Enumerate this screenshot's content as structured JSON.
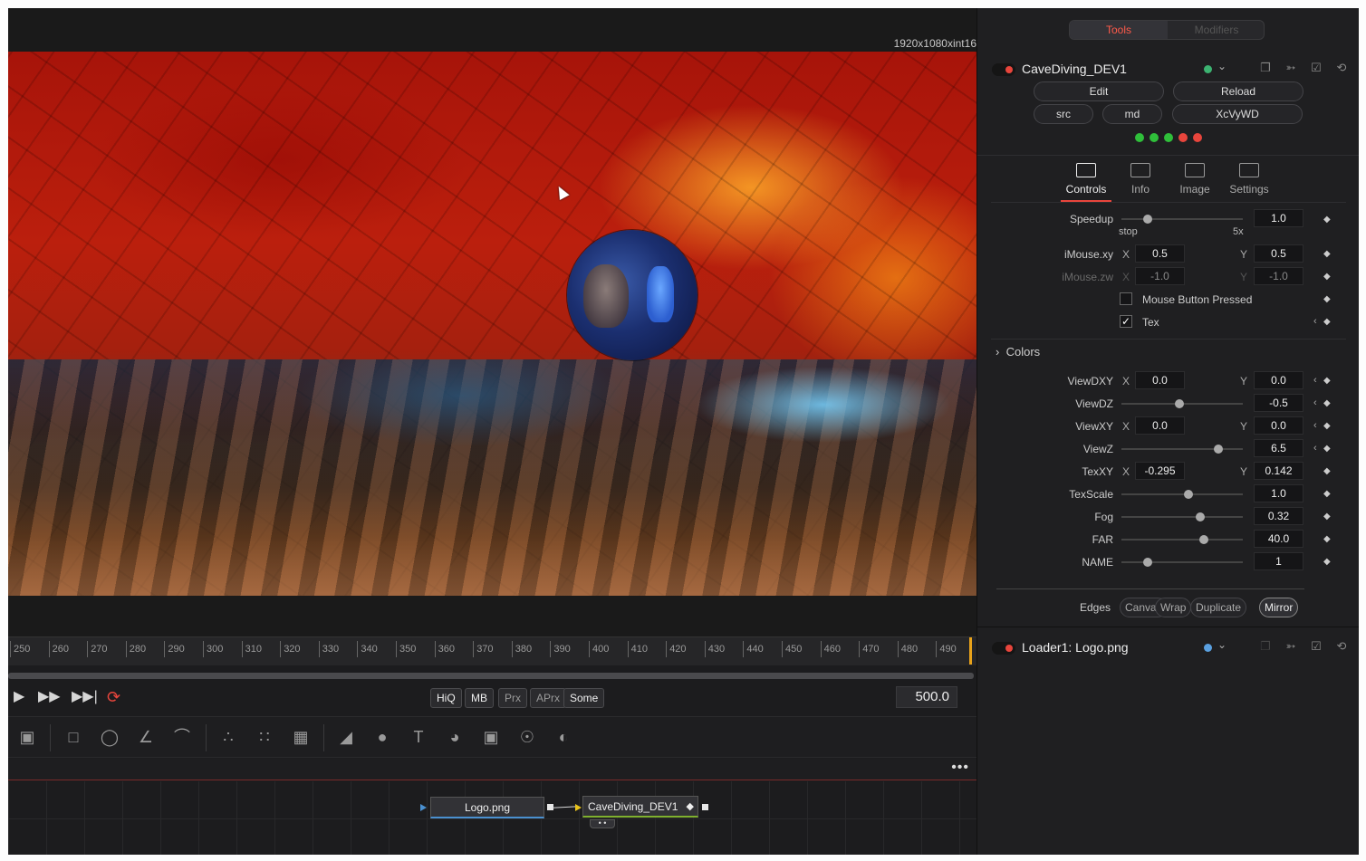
{
  "viewer": {
    "resolution": "1920x1080xint16"
  },
  "timeline": {
    "ticks": [
      "250",
      "260",
      "270",
      "280",
      "290",
      "300",
      "310",
      "320",
      "330",
      "340",
      "350",
      "360",
      "370",
      "380",
      "390",
      "400",
      "410",
      "420",
      "430",
      "440",
      "450",
      "460",
      "470",
      "480",
      "490"
    ],
    "current_frame": "500.0"
  },
  "transport": {
    "play_icon": "play-icon",
    "fast_forward_icon": "fast-forward-icon",
    "skip_end_icon": "skip-to-end-icon",
    "loop_icon": "loop-icon",
    "quality": {
      "hiq": "HiQ",
      "mb": "MB",
      "prx": "Prx",
      "aprx": "APrx",
      "some": "Some"
    }
  },
  "toolbar": {
    "tools": [
      "background-icon",
      "rectangle-icon",
      "ellipse-icon",
      "polygon-icon",
      "bspline-icon",
      "particle-emitter-icon",
      "particle-render-icon",
      "pipe-router-icon",
      "image-plane-3d-icon",
      "shape-3d-icon",
      "text-3d-icon",
      "merge-3d-icon",
      "renderer-3d-icon",
      "point-light-icon",
      "camera-3d-icon"
    ]
  },
  "node_editor": {
    "more_label": "•••",
    "nodes": {
      "logo": "Logo.png",
      "cave": "CaveDiving_DEV1"
    }
  },
  "inspector": {
    "tabs": {
      "tools": "Tools",
      "modifiers": "Modifiers"
    },
    "node1": {
      "name": "CaveDiving_DEV1",
      "status_color": "#3cb371",
      "buttons": {
        "edit": "Edit",
        "reload": "Reload",
        "src": "src",
        "md": "md",
        "shader_id": "XcVyWD"
      },
      "status_dots": [
        "#2fbf3a",
        "#2fbf3a",
        "#2fbf3a",
        "#e8453c",
        "#e8453c"
      ]
    },
    "panel_tabs": {
      "controls": "Controls",
      "info": "Info",
      "image": "Image",
      "settings": "Settings"
    },
    "controls": {
      "speedup": {
        "label": "Speedup",
        "value": "1.0",
        "min_label": "stop",
        "max_label": "5x",
        "level": 0.22
      },
      "imouse_xy": {
        "label": "iMouse.xy",
        "x": "0.5",
        "y": "0.5"
      },
      "imouse_zw": {
        "label": "iMouse.zw",
        "x": "-1.0",
        "y": "-1.0"
      },
      "mouse_button": {
        "label": "Mouse Button Pressed",
        "checked": false
      },
      "tex": {
        "label": "Tex",
        "checked": true
      },
      "colors_label": "Colors",
      "viewdxy": {
        "label": "ViewDXY",
        "x": "0.0",
        "y": "0.0"
      },
      "viewdz": {
        "label": "ViewDZ",
        "value": "-0.5",
        "level": 0.48
      },
      "viewxy": {
        "label": "ViewXY",
        "x": "0.0",
        "y": "0.0"
      },
      "viewz": {
        "label": "ViewZ",
        "value": "6.5",
        "level": 0.8
      },
      "texxy": {
        "label": "TexXY",
        "x": "-0.295",
        "y": "0.142"
      },
      "texscale": {
        "label": "TexScale",
        "value": "1.0",
        "level": 0.55
      },
      "fog": {
        "label": "Fog",
        "value": "0.32",
        "level": 0.65
      },
      "far": {
        "label": "FAR",
        "value": "40.0",
        "level": 0.68
      },
      "name": {
        "label": "NAME",
        "value": "1",
        "level": 0.22
      },
      "edges": {
        "label": "Edges",
        "options": [
          "Canvas",
          "Wrap",
          "Duplicate",
          "Mirror"
        ],
        "selected": "Mirror"
      },
      "axis_x": "X",
      "axis_y": "Y",
      "keyframe_icon": "keyframe-diamond-icon"
    },
    "node2": {
      "name": "Loader1: Logo.png",
      "status_color": "#5aa0e0"
    }
  }
}
